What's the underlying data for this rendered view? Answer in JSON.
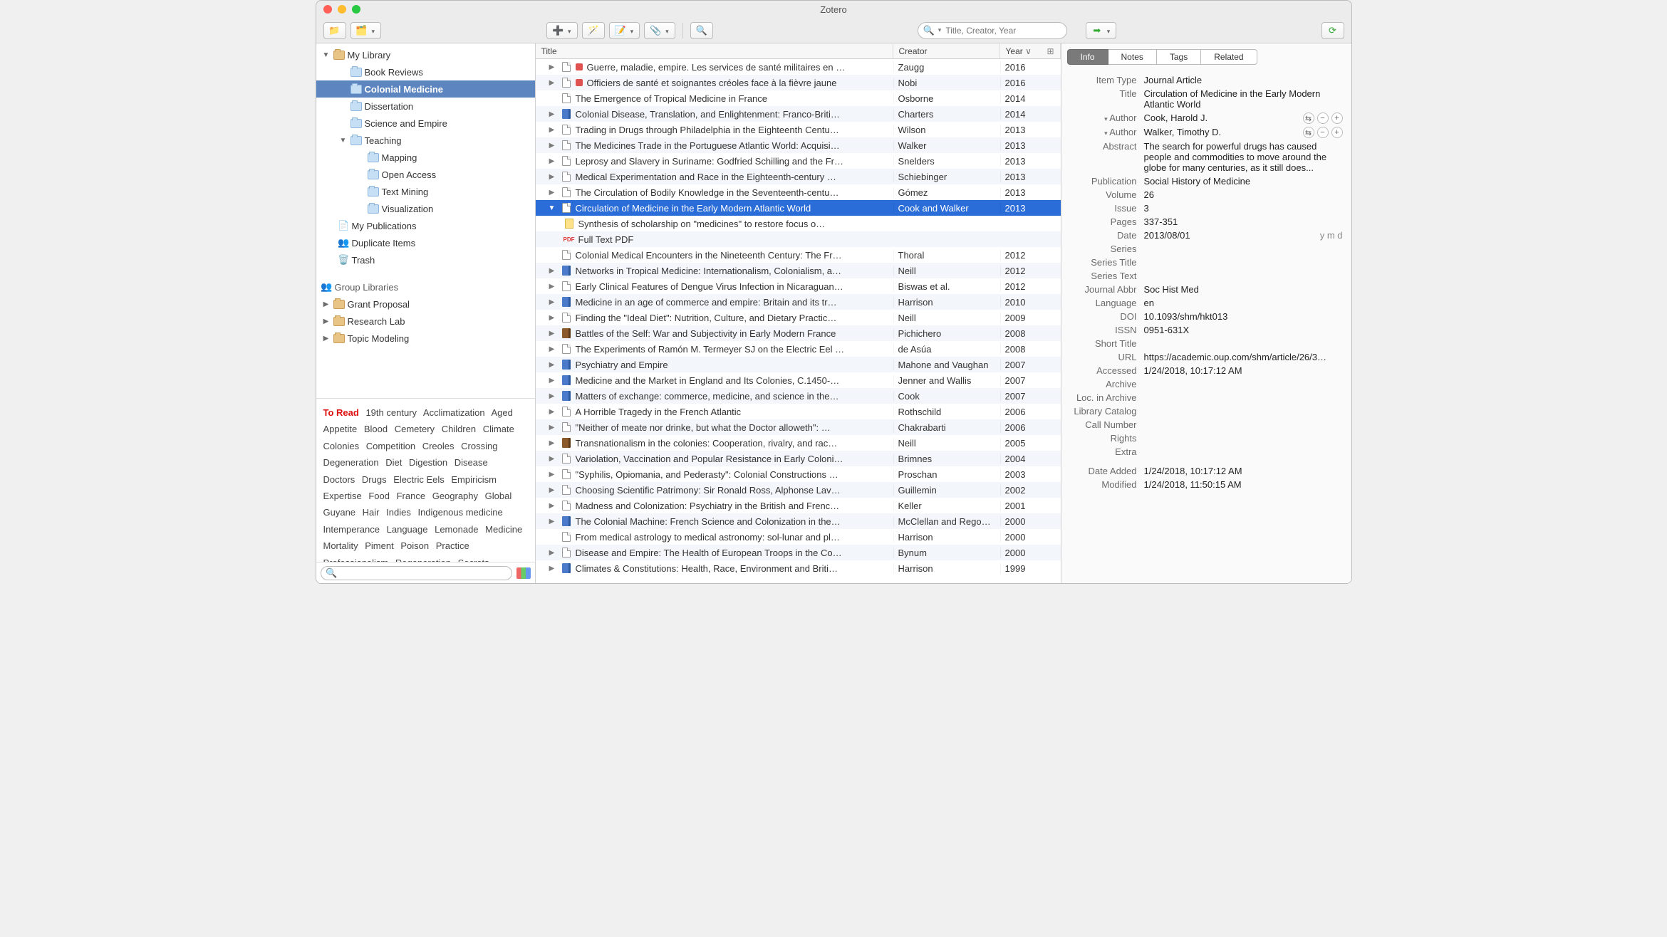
{
  "windowTitle": "Zotero",
  "search": {
    "placeholder": "Title, Creator, Year"
  },
  "tabs": {
    "info": "Info",
    "notes": "Notes",
    "tags": "Tags",
    "related": "Related"
  },
  "cols": {
    "title": "Title",
    "creator": "Creator",
    "year": "Year"
  },
  "sidebar": {
    "mylibrary": "My Library",
    "items": [
      {
        "label": "Book Reviews",
        "indent": 1
      },
      {
        "label": "Colonial Medicine",
        "indent": 1,
        "selected": true
      },
      {
        "label": "Dissertation",
        "indent": 1
      },
      {
        "label": "Science and Empire",
        "indent": 1
      },
      {
        "label": "Teaching",
        "indent": 1,
        "twisty": "▼"
      },
      {
        "label": "Mapping",
        "indent": 2
      },
      {
        "label": "Open Access",
        "indent": 2
      },
      {
        "label": "Text Mining",
        "indent": 2
      },
      {
        "label": "Visualization",
        "indent": 2
      }
    ],
    "pubs": "My Publications",
    "dups": "Duplicate Items",
    "trash": "Trash",
    "group": "Group Libraries",
    "groups": [
      {
        "label": "Grant Proposal"
      },
      {
        "label": "Research Lab"
      },
      {
        "label": "Topic Modeling"
      }
    ]
  },
  "tags": [
    "To Read",
    "19th century",
    "Acclimatization",
    "Aged",
    "Appetite",
    "Blood",
    "Cemetery",
    "Children",
    "Climate",
    "Colonies",
    "Competition",
    "Creoles",
    "Crossing",
    "Degeneration",
    "Diet",
    "Digestion",
    "Disease",
    "Doctors",
    "Drugs",
    "Electric Eels",
    "Empiricism",
    "Expertise",
    "Food",
    "France",
    "Geography",
    "Global",
    "Guyane",
    "Hair",
    "Indies",
    "Indigenous medicine",
    "Intemperance",
    "Language",
    "Lemonade",
    "Medicine",
    "Mortality",
    "Piment",
    "Poison",
    "Practice",
    "Professionalism",
    "Regeneration",
    "Secrets"
  ],
  "rows": [
    {
      "tw": "▶",
      "icon": "doc",
      "clr": "red",
      "title": "Guerre, maladie, empire. Les services de santé militaires en …",
      "creator": "Zaugg",
      "year": "2016"
    },
    {
      "tw": "▶",
      "icon": "doc",
      "clr": "red",
      "title": "Officiers de santé et soignantes créoles face à la fièvre jaune",
      "creator": "Nobi",
      "year": "2016"
    },
    {
      "tw": "",
      "icon": "doc",
      "title": "The Emergence of Tropical Medicine in France",
      "creator": "Osborne",
      "year": "2014"
    },
    {
      "tw": "▶",
      "icon": "book",
      "title": "Colonial Disease, Translation, and Enlightenment: Franco-Briti…",
      "creator": "Charters",
      "year": "2014"
    },
    {
      "tw": "▶",
      "icon": "doc",
      "title": "Trading in Drugs through Philadelphia in the Eighteenth Centu…",
      "creator": "Wilson",
      "year": "2013"
    },
    {
      "tw": "▶",
      "icon": "doc",
      "title": "The Medicines Trade in the Portuguese Atlantic World: Acquisi…",
      "creator": "Walker",
      "year": "2013"
    },
    {
      "tw": "▶",
      "icon": "doc",
      "title": "Leprosy and Slavery in Suriname: Godfried Schilling and the Fr…",
      "creator": "Snelders",
      "year": "2013"
    },
    {
      "tw": "▶",
      "icon": "doc",
      "title": "Medical Experimentation and Race in the Eighteenth-century …",
      "creator": "Schiebinger",
      "year": "2013"
    },
    {
      "tw": "▶",
      "icon": "doc",
      "title": "The Circulation of Bodily Knowledge in the Seventeenth-centu…",
      "creator": "Gómez",
      "year": "2013"
    },
    {
      "tw": "▼",
      "icon": "doc",
      "title": "Circulation of Medicine in the Early Modern Atlantic World",
      "creator": "Cook and Walker",
      "year": "2013",
      "selected": true
    },
    {
      "child": true,
      "icon": "note",
      "title": "Synthesis of scholarship on \"medicines\" to restore focus o…",
      "creator": "",
      "year": ""
    },
    {
      "child": true,
      "icon": "pdf",
      "title": "Full Text PDF",
      "creator": "",
      "year": ""
    },
    {
      "tw": "",
      "icon": "doc",
      "title": "Colonial Medical Encounters in the Nineteenth Century: The Fr…",
      "creator": "Thoral",
      "year": "2012"
    },
    {
      "tw": "▶",
      "icon": "book",
      "title": "Networks in Tropical Medicine: Internationalism, Colonialism, a…",
      "creator": "Neill",
      "year": "2012"
    },
    {
      "tw": "▶",
      "icon": "doc",
      "title": "Early Clinical Features of Dengue Virus Infection in Nicaraguan…",
      "creator": "Biswas et al.",
      "year": "2012"
    },
    {
      "tw": "▶",
      "icon": "book",
      "title": "Medicine in an age of commerce and empire: Britain and its tr…",
      "creator": "Harrison",
      "year": "2010"
    },
    {
      "tw": "▶",
      "icon": "doc",
      "title": "Finding the \"Ideal Diet\": Nutrition, Culture, and Dietary Practic…",
      "creator": "Neill",
      "year": "2009"
    },
    {
      "tw": "▶",
      "icon": "bookbrown",
      "title": "Battles of the Self: War and Subjectivity in Early Modern France",
      "creator": "Pichichero",
      "year": "2008"
    },
    {
      "tw": "▶",
      "icon": "doc",
      "title": "The Experiments of Ramón M. Termeyer SJ on the Electric Eel …",
      "creator": "de Asúa",
      "year": "2008"
    },
    {
      "tw": "▶",
      "icon": "book",
      "title": "Psychiatry and Empire",
      "creator": "Mahone and Vaughan",
      "year": "2007"
    },
    {
      "tw": "▶",
      "icon": "book",
      "title": "Medicine and the Market in England and Its Colonies, C.1450-…",
      "creator": "Jenner and Wallis",
      "year": "2007"
    },
    {
      "tw": "▶",
      "icon": "book",
      "title": "Matters of exchange: commerce, medicine, and science in the…",
      "creator": "Cook",
      "year": "2007"
    },
    {
      "tw": "▶",
      "icon": "doc",
      "title": "A Horrible Tragedy in the French Atlantic",
      "creator": "Rothschild",
      "year": "2006"
    },
    {
      "tw": "▶",
      "icon": "doc",
      "title": "\"Neither of meate nor drinke, but what the Doctor alloweth\": …",
      "creator": "Chakrabarti",
      "year": "2006"
    },
    {
      "tw": "▶",
      "icon": "bookbrown",
      "title": "Transnationalism in the colonies: Cooperation, rivalry, and rac…",
      "creator": "Neill",
      "year": "2005"
    },
    {
      "tw": "▶",
      "icon": "doc",
      "title": "Variolation, Vaccination and Popular Resistance in Early Coloni…",
      "creator": "Brimnes",
      "year": "2004"
    },
    {
      "tw": "▶",
      "icon": "doc",
      "title": "\"Syphilis, Opiomania, and Pederasty\": Colonial Constructions …",
      "creator": "Proschan",
      "year": "2003"
    },
    {
      "tw": "▶",
      "icon": "doc",
      "title": "Choosing Scientific Patrimony: Sir Ronald Ross, Alphonse Lav…",
      "creator": "Guillemin",
      "year": "2002"
    },
    {
      "tw": "▶",
      "icon": "doc",
      "title": "Madness and Colonization: Psychiatry in the British and Frenc…",
      "creator": "Keller",
      "year": "2001"
    },
    {
      "tw": "▶",
      "icon": "book",
      "title": "The Colonial Machine: French Science and Colonization in the…",
      "creator": "McClellan and Rego…",
      "year": "2000"
    },
    {
      "tw": "",
      "icon": "doc",
      "title": "From medical astrology to medical astronomy: sol-lunar and pl…",
      "creator": "Harrison",
      "year": "2000"
    },
    {
      "tw": "▶",
      "icon": "doc",
      "title": "Disease and Empire: The Health of European Troops in the Co…",
      "creator": "Bynum",
      "year": "2000"
    },
    {
      "tw": "▶",
      "icon": "book",
      "title": "Climates & Constitutions: Health, Race, Environment and Briti…",
      "creator": "Harrison",
      "year": "1999"
    }
  ],
  "item": {
    "type_label": "Item Type",
    "type": "Journal Article",
    "title_label": "Title",
    "title": "Circulation of Medicine in the Early Modern Atlantic World",
    "author_label": "Author",
    "author1": "Cook, Harold J.",
    "author2": "Walker, Timothy D.",
    "abstract_label": "Abstract",
    "abstract": "The search for powerful drugs has caused people and commodities to move around the globe for many centuries, as it still does...",
    "publication_label": "Publication",
    "publication": "Social History of Medicine",
    "volume_label": "Volume",
    "volume": "26",
    "issue_label": "Issue",
    "issue": "3",
    "pages_label": "Pages",
    "pages": "337-351",
    "date_label": "Date",
    "date": "2013/08/01",
    "date_fmt": "y m d",
    "series_label": "Series",
    "series": "",
    "seriestitle_label": "Series Title",
    "seriestitle": "",
    "seriestext_label": "Series Text",
    "seriestext": "",
    "journalabbr_label": "Journal Abbr",
    "journalabbr": "Soc Hist Med",
    "language_label": "Language",
    "language": "en",
    "doi_label": "DOI",
    "doi": "10.1093/shm/hkt013",
    "issn_label": "ISSN",
    "issn": "0951-631X",
    "shorttitle_label": "Short Title",
    "shorttitle": "",
    "url_label": "URL",
    "url": "https://academic.oup.com/shm/article/26/3…",
    "accessed_label": "Accessed",
    "accessed": "1/24/2018, 10:17:12 AM",
    "archive_label": "Archive",
    "archive": "",
    "locinarchive_label": "Loc. in Archive",
    "locinarchive": "",
    "librarycatalog_label": "Library Catalog",
    "librarycatalog": "",
    "callnumber_label": "Call Number",
    "callnumber": "",
    "rights_label": "Rights",
    "rights": "",
    "extra_label": "Extra",
    "extra": "",
    "dateadded_label": "Date Added",
    "dateadded": "1/24/2018, 10:17:12 AM",
    "modified_label": "Modified",
    "modified": "1/24/2018, 11:50:15 AM"
  }
}
